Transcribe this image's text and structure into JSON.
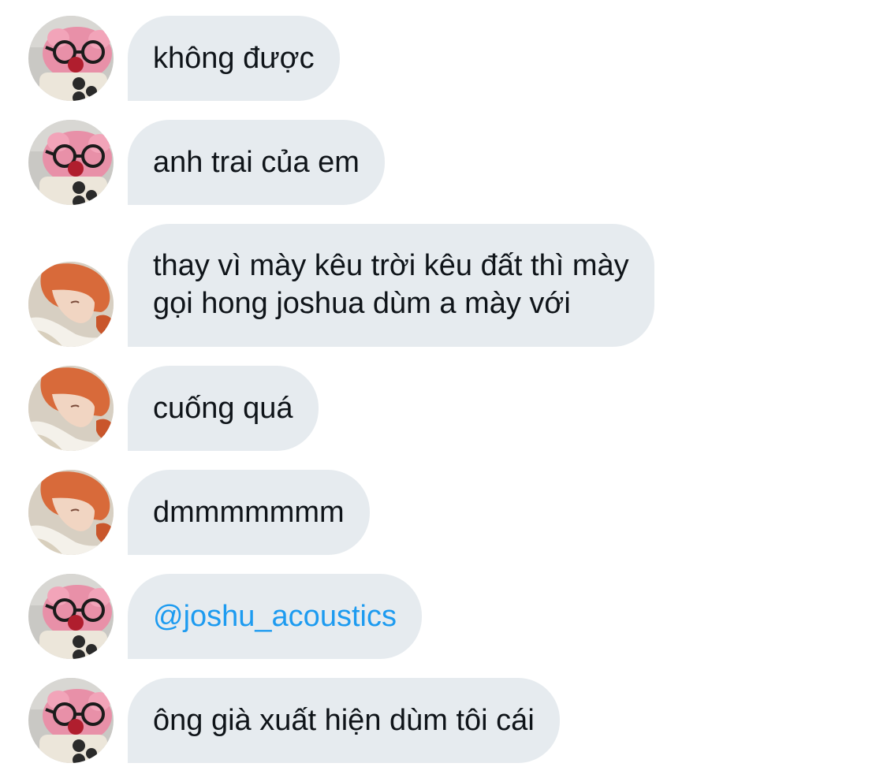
{
  "messages": [
    {
      "sender": "pink-avatar",
      "text": "không được"
    },
    {
      "sender": "pink-avatar",
      "text": "anh trai của em"
    },
    {
      "sender": "orange-hair-avatar",
      "lines": [
        "thay vì mày kêu trời kêu đất thì mày",
        "gọi hong joshua dùm a mày với"
      ]
    },
    {
      "sender": "orange-hair-avatar",
      "text": "cuống quá"
    },
    {
      "sender": "orange-hair-avatar",
      "text": "dmmmmmmm"
    },
    {
      "sender": "pink-avatar",
      "text": "@joshu_acoustics",
      "is_mention": true
    },
    {
      "sender": "pink-avatar",
      "text": "ông già xuất hiện dùm tôi cái"
    }
  ],
  "colors": {
    "bubble_bg": "#e6ebef",
    "text": "#0f1419",
    "mention": "#1d9bf0",
    "background": "#ffffff"
  },
  "icons": [
    "pink-plush-glasses-avatar-icon",
    "orange-hair-person-avatar-icon"
  ]
}
